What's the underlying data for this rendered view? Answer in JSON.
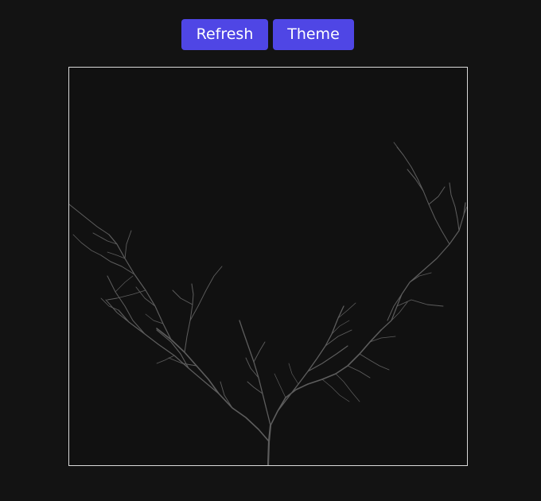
{
  "toolbar": {
    "refresh_label": "Refresh",
    "theme_label": "Theme"
  },
  "canvas": {
    "background": "#111111",
    "border_color": "#d9d9d9",
    "branch_color": "#6b6b6b"
  },
  "colors": {
    "page_background": "#131313",
    "button_background": "#4f46e5",
    "button_text": "#ffffff"
  }
}
